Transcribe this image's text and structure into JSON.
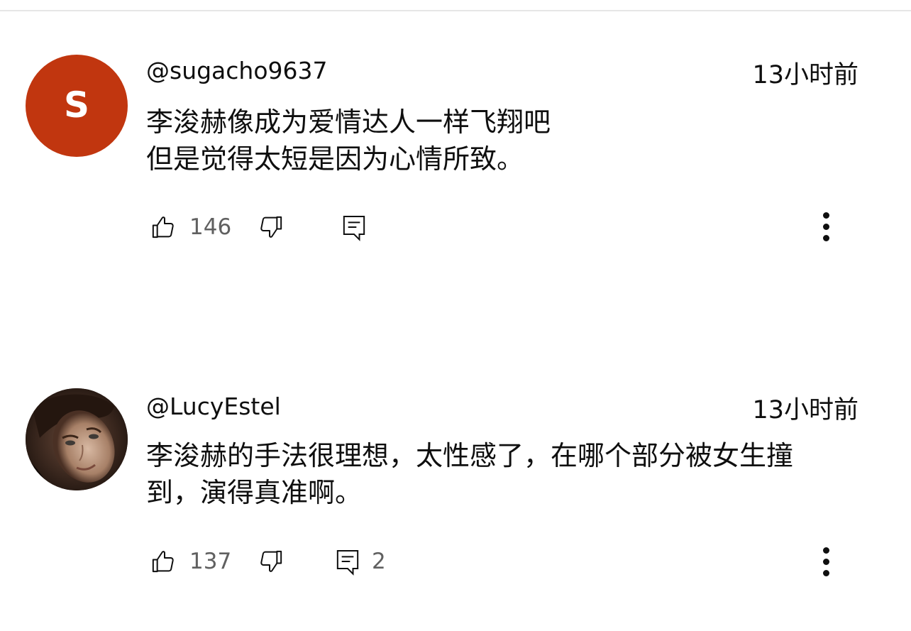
{
  "comments": [
    {
      "avatar_letter": "S",
      "avatar_color": "#c1360f",
      "username": "@sugacho9637",
      "time": "13小时前",
      "lines": [
        "李浚赫像成为爱情达人一样飞翔吧",
        "但是觉得太短是因为心情所致。"
      ],
      "likes": "146",
      "replies": ""
    },
    {
      "avatar_letter": "",
      "avatar_color": "#2a1d17",
      "username": "@LucyEstel",
      "time": "13小时前",
      "lines": [
        "李浚赫的手法很理想，太性感了，在哪个部分被女生撞",
        "到，演得真准啊。"
      ],
      "likes": "137",
      "replies": "2"
    }
  ],
  "icons": {
    "like": "thumbs-up-icon",
    "dislike": "thumbs-down-icon",
    "reply": "comment-icon",
    "more": "more-vertical-icon"
  }
}
